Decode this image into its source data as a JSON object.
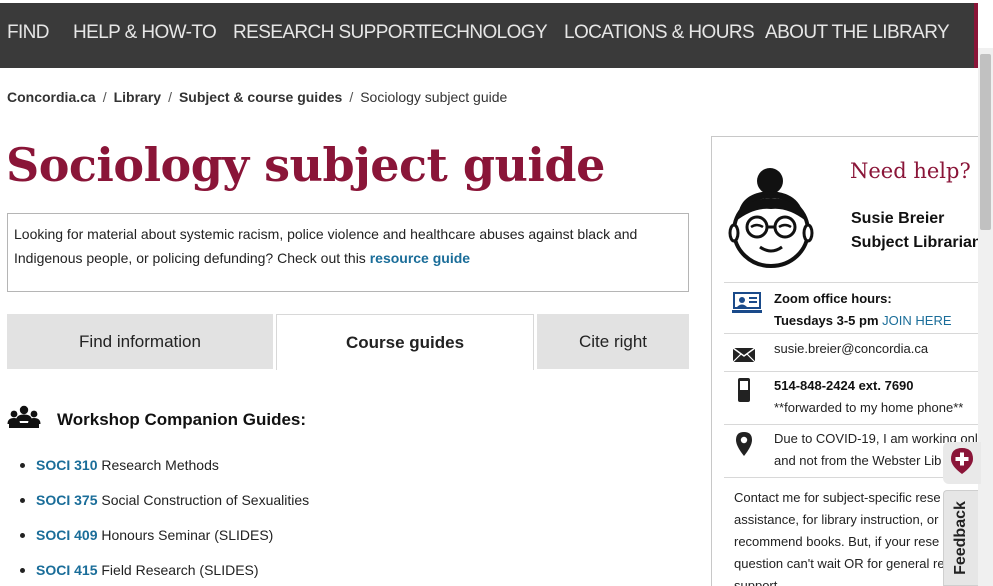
{
  "nav": {
    "items": [
      "FIND",
      "HELP & HOW-TO",
      "RESEARCH SUPPORT",
      "TECHNOLOGY",
      "LOCATIONS & HOURS",
      "ABOUT THE LIBRARY"
    ]
  },
  "breadcrumb": {
    "items": [
      "Concordia.ca",
      "Library",
      "Subject & course guides",
      "Sociology subject guide"
    ],
    "separator": "/"
  },
  "page": {
    "title": "Sociology subject guide"
  },
  "notice": {
    "text": "Looking for material about systemic racism, police violence and healthcare abuses against black and Indigenous people, or policing defunding? Check out this ",
    "link": "resource guide"
  },
  "tabs": [
    {
      "label": "Find information",
      "active": false
    },
    {
      "label": "Course guides",
      "active": true
    },
    {
      "label": "Cite right",
      "active": false
    }
  ],
  "workshop": {
    "heading": "Workshop Companion Guides:",
    "icon": "people-group-icon",
    "guides": [
      {
        "code": "SOCI 310",
        "title": "Research Methods"
      },
      {
        "code": "SOCI 375",
        "title": "Social Construction of Sexualities"
      },
      {
        "code": "SOCI 409",
        "title": "Honours Seminar (SLIDES)"
      },
      {
        "code": "SOCI 415",
        "title": "Field Research (SLIDES)"
      }
    ]
  },
  "help": {
    "heading": "Need help?",
    "name": "Susie Breier",
    "role": "Subject Librarian",
    "zoom_label": "Zoom office hours:",
    "zoom_hours": "Tuesdays 3-5 pm",
    "zoom_link": "JOIN HERE",
    "email": "susie.breier@concordia.ca",
    "phone": "514-848-2424 ext. 7690",
    "phone_note": "**forwarded to my home phone**",
    "location_line1": "Due to COVID-19, I am working onl",
    "location_line2": "and not from the Webster Lib",
    "blurb_lines": [
      "Contact me for subject-specific rese",
      "assistance, for library instruction, or",
      "recommend books. But, if your rese",
      "question can't wait OR for general re",
      "support"
    ]
  },
  "widgets": {
    "feedback_label": "Feedback"
  },
  "colors": {
    "brand": "#8a1538",
    "nav_bg": "#3a3a3a",
    "link": "#1a6d99",
    "tab_inactive": "#e2e2e2"
  }
}
